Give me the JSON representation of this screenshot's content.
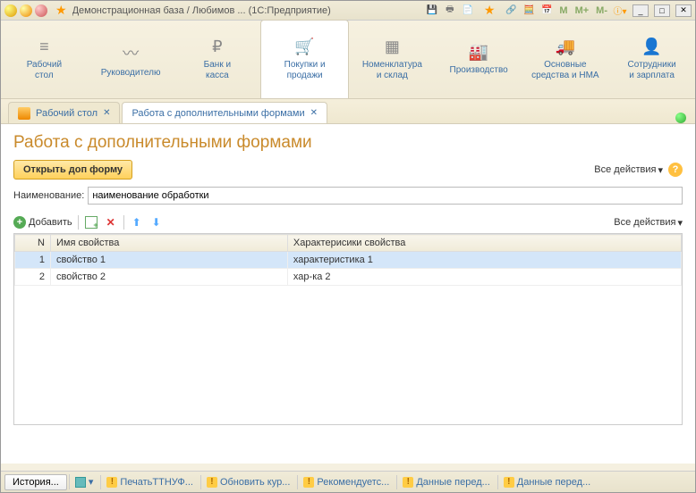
{
  "window": {
    "title": "Демонстрационная база / Любимов ...   (1С:Предприятие)"
  },
  "titlebar_m": {
    "m": "M",
    "mp": "M+",
    "mm": "M-"
  },
  "nav": {
    "items": [
      {
        "label": "Рабочий\nстол",
        "icon": "≡"
      },
      {
        "label": "Руководителю",
        "icon": "〰"
      },
      {
        "label": "Банк и\nкасса",
        "icon": "₽"
      },
      {
        "label": "Покупки и\nпродажи",
        "icon": "🛒"
      },
      {
        "label": "Номенклатура\nи склад",
        "icon": "▦"
      },
      {
        "label": "Производство",
        "icon": "🏭"
      },
      {
        "label": "Основные\nсредства и НМА",
        "icon": "🚚"
      },
      {
        "label": "Сотрудники\nи зарплата",
        "icon": "👤"
      }
    ]
  },
  "tabs": {
    "items": [
      {
        "label": "Рабочий стол"
      },
      {
        "label": "Работа с дополнительными формами"
      }
    ]
  },
  "page": {
    "heading": "Работа с дополнительными формами",
    "open_btn": "Открыть доп форму",
    "all_actions": "Все действия",
    "name_label": "Наименование:",
    "name_value": "наименование обработки",
    "add_label": "Добавить"
  },
  "table": {
    "cols": {
      "n": "N",
      "name": "Имя свойства",
      "char": "Характерисики свойства"
    },
    "rows": [
      {
        "n": "1",
        "name": "свойство 1",
        "char": "характеристика 1"
      },
      {
        "n": "2",
        "name": "свойство 2",
        "char": "хар-ка 2"
      }
    ]
  },
  "status": {
    "history": "История...",
    "items": [
      {
        "label": "ПечатьТТНУФ..."
      },
      {
        "label": "Обновить кур..."
      },
      {
        "label": "Рекомендуетс..."
      },
      {
        "label": "Данные перед..."
      },
      {
        "label": "Данные перед..."
      }
    ]
  }
}
